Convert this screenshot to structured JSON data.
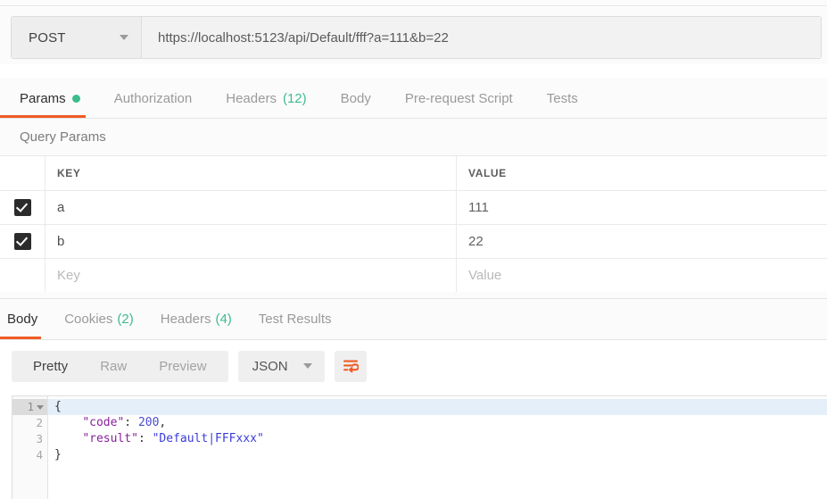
{
  "request": {
    "method": "POST",
    "method_caret_icon": "chevron-down-icon",
    "url": "https://localhost:5123/api/Default/fff?a=111&b=22"
  },
  "request_tabs": [
    {
      "label": "Params",
      "indicator": "green-dot",
      "active": true
    },
    {
      "label": "Authorization",
      "active": false
    },
    {
      "label": "Headers",
      "count": "(12)",
      "active": false
    },
    {
      "label": "Body",
      "active": false
    },
    {
      "label": "Pre-request Script",
      "active": false
    },
    {
      "label": "Tests",
      "active": false
    }
  ],
  "query_params": {
    "section_title": "Query Params",
    "columns": {
      "key": "KEY",
      "value": "VALUE"
    },
    "rows": [
      {
        "checked": true,
        "key": "a",
        "value": "111"
      },
      {
        "checked": true,
        "key": "b",
        "value": "22"
      }
    ],
    "new_row": {
      "key_placeholder": "Key",
      "value_placeholder": "Value"
    }
  },
  "response_tabs": [
    {
      "label": "Body",
      "active": true
    },
    {
      "label": "Cookies",
      "count": "(2)",
      "active": false
    },
    {
      "label": "Headers",
      "count": "(4)",
      "active": false
    },
    {
      "label": "Test Results",
      "active": false
    }
  ],
  "body_toolbar": {
    "views": [
      {
        "label": "Pretty",
        "active": true
      },
      {
        "label": "Raw",
        "active": false
      },
      {
        "label": "Preview",
        "active": false
      }
    ],
    "format": "JSON",
    "format_caret_icon": "chevron-down-icon",
    "wrap_icon": "word-wrap-icon"
  },
  "editor": {
    "lines": [
      {
        "num": "1",
        "current": true,
        "foldable": true
      },
      {
        "num": "2",
        "current": false,
        "foldable": false
      },
      {
        "num": "3",
        "current": false,
        "foldable": false
      },
      {
        "num": "4",
        "current": false,
        "foldable": false
      }
    ],
    "line1": "{",
    "line2_key": "\"code\"",
    "line2_sep": ": ",
    "line2_num": "200",
    "line2_comma": ",",
    "line3_key": "\"result\"",
    "line3_sep": ": ",
    "line3_str": "\"Default|FFFxxx\"",
    "line4": "}"
  },
  "colors": {
    "accent": "#ef5b25",
    "green": "#3cbc8d",
    "checkbox": "#2b2b2b",
    "json_string": "#3b3bdb",
    "json_key": "#88219b"
  }
}
